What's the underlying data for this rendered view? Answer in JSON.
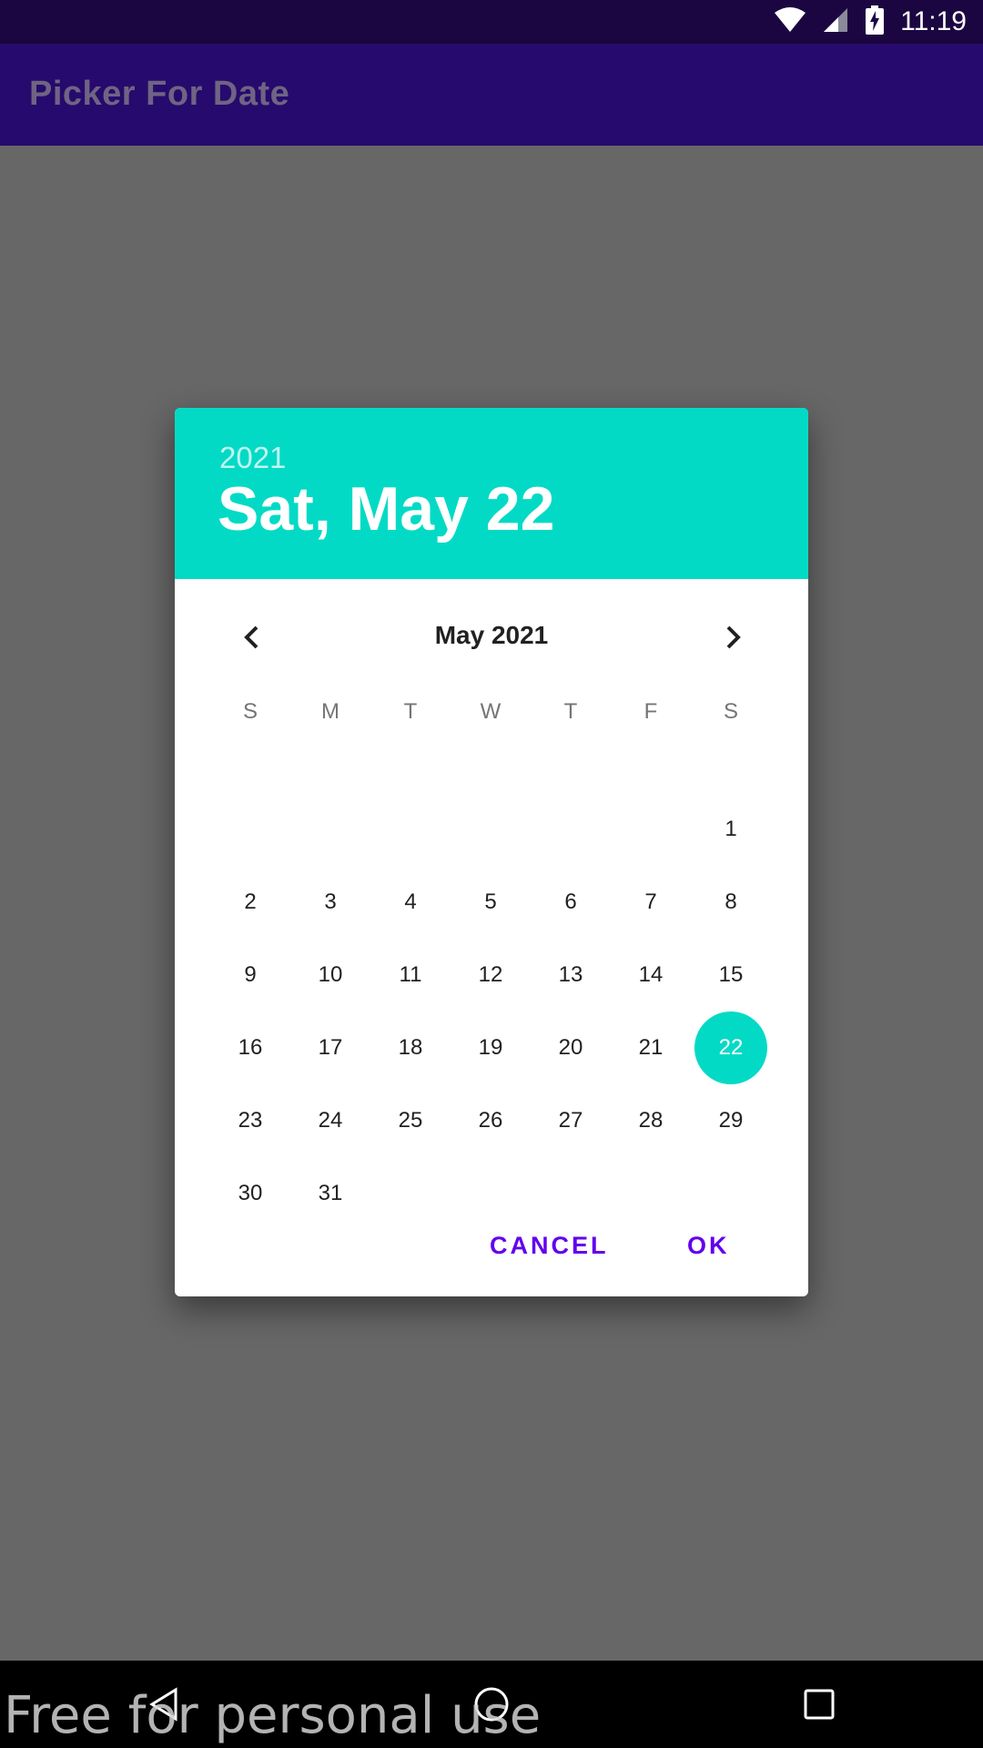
{
  "status_bar": {
    "time": "11:19"
  },
  "app_bar": {
    "title": "Picker For Date"
  },
  "dialog": {
    "header_year": "2021",
    "header_date": "Sat, May 22",
    "month_label": "May 2021",
    "weekdays": [
      "S",
      "M",
      "T",
      "W",
      "T",
      "F",
      "S"
    ],
    "days": [
      "1",
      "2",
      "3",
      "4",
      "5",
      "6",
      "7",
      "8",
      "9",
      "10",
      "11",
      "12",
      "13",
      "14",
      "15",
      "16",
      "17",
      "18",
      "19",
      "20",
      "21",
      "22",
      "23",
      "24",
      "25",
      "26",
      "27",
      "28",
      "29",
      "30",
      "31"
    ],
    "selected_day": "22",
    "cancel_label": "CANCEL",
    "ok_label": "OK"
  },
  "watermark": "Free for personal use",
  "colors": {
    "accent": "#03dac5",
    "primary": "#6200ee",
    "app_bar": "#270a6d"
  }
}
